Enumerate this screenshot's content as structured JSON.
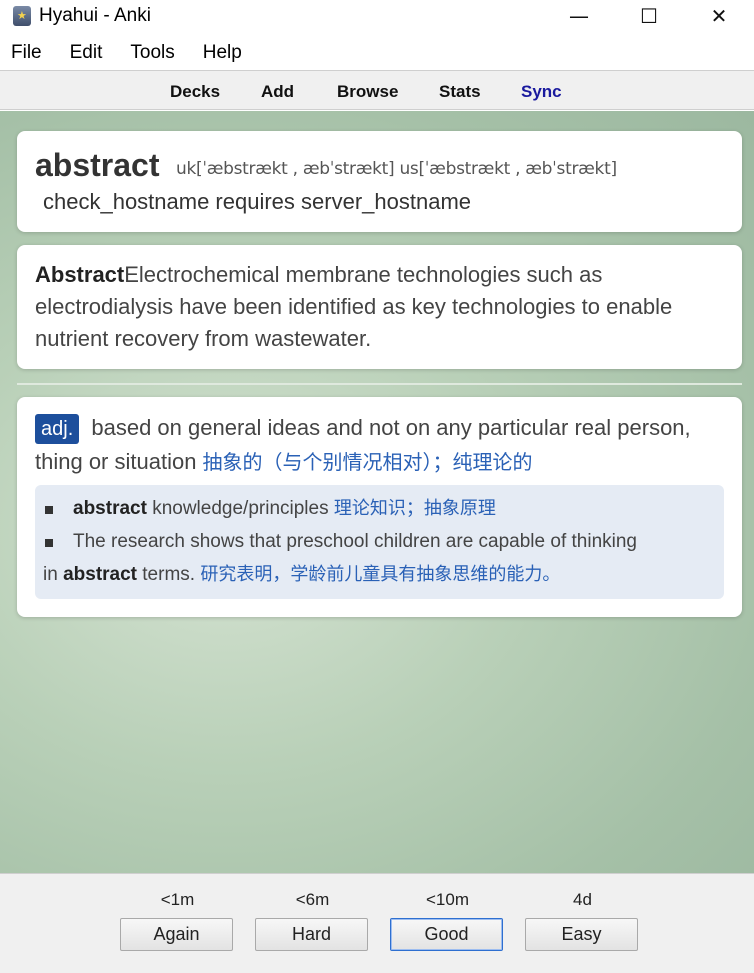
{
  "window": {
    "title": "Hyahui - Anki",
    "controls": {
      "minimize": "—",
      "maximize": "☐",
      "close": "✕"
    }
  },
  "menu": [
    "File",
    "Edit",
    "Tools",
    "Help"
  ],
  "toolbar": {
    "decks": "Decks",
    "add": "Add",
    "browse": "Browse",
    "stats": "Stats",
    "sync": "Sync"
  },
  "card": {
    "word": "abstract",
    "phonetic": "uk[ˈæbstrækt , æbˈstrækt] us[ˈæbstrækt , æbˈstrækt]",
    "subtitle": "check_hostname requires server_hostname",
    "sentence_bold": "Abstract",
    "sentence_rest": "Electrochemical membrane technologies such as electrodialysis have been identified as key technologies to enable nutrient recovery from wastewater.",
    "pos": "adj.",
    "definition": " based on general ideas and not on any particular real person, thing or situation ",
    "definition_cn": "抽象的（与个别情况相对）；纯理论的",
    "examples": [
      {
        "bold": "abstract",
        "rest": " knowledge/principles ",
        "cn": "理论知识；抽象原理"
      },
      {
        "pre": "The research shows that preschool children are capable of thinking",
        "pre2": "in ",
        "bold": "abstract",
        "rest": " terms. ",
        "cn": "研究表明，学龄前儿童具有抽象思维的能力。"
      }
    ]
  },
  "answers": [
    {
      "interval": "<1m",
      "label": "Again"
    },
    {
      "interval": "<6m",
      "label": "Hard"
    },
    {
      "interval": "<10m",
      "label": "Good"
    },
    {
      "interval": "4d",
      "label": "Easy"
    }
  ],
  "colors": {
    "sync": "#1a1a9e",
    "pos_badge": "#1d4f9c",
    "chinese_text": "#2a61b6",
    "example_bg": "#e5ebf4"
  }
}
